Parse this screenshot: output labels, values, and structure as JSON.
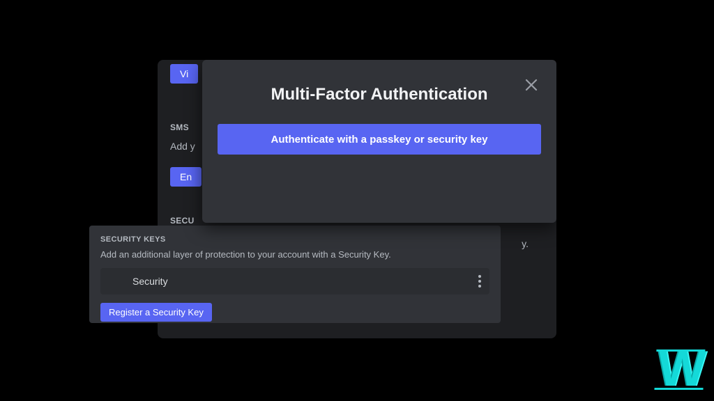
{
  "colors": {
    "accent": "#5865f2",
    "panel_dark": "#1e1f22",
    "panel_light": "#313338",
    "text_muted": "#b5bac1",
    "watermark": "#14d9d8"
  },
  "background_panel": {
    "partial_button_top": "Vi",
    "sms_section_label": "SMS",
    "sms_desc_fragment": "Add y",
    "partial_button_mid": "En",
    "security_section_label": "SECU",
    "key_tail_fragment": "y."
  },
  "security_keys_panel": {
    "title": "SECURITY KEYS",
    "description": "Add an additional layer of protection to your account with a Security Key.",
    "keys": [
      {
        "name": "Security"
      }
    ],
    "register_label": "Register a Security Key"
  },
  "modal": {
    "title": "Multi-Factor Authentication",
    "authenticate_label": "Authenticate with a passkey or security key",
    "close_icon": "close-icon"
  },
  "watermark": {
    "glyph": "W"
  }
}
